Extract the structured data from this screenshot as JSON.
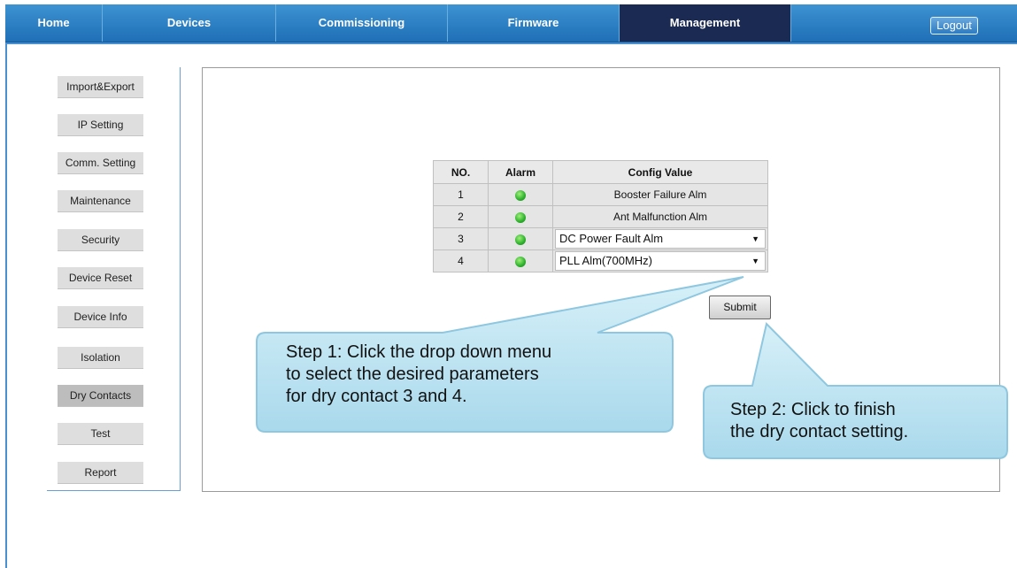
{
  "nav": {
    "items": [
      "Home",
      "Devices",
      "Commissioning",
      "Firmware",
      "Management"
    ],
    "active": "Management",
    "logout": "Logout"
  },
  "sidebar": {
    "items": [
      "Import&Export",
      "IP Setting",
      "Comm. Setting",
      "Maintenance",
      "Security",
      "Device Reset",
      "Device Info",
      "Isolation",
      "Dry Contacts",
      "Test",
      "Report"
    ],
    "active": "Dry Contacts"
  },
  "table": {
    "headers": [
      "NO.",
      "Alarm",
      "Config Value"
    ],
    "rows": [
      {
        "no": "1",
        "value": "Booster Failure Alm"
      },
      {
        "no": "2",
        "value": "Ant Malfunction Alm"
      },
      {
        "no": "3",
        "value": "DC Power Fault Alm"
      },
      {
        "no": "4",
        "value": "PLL Alm(700MHz)"
      }
    ]
  },
  "submit": "Submit",
  "callouts": {
    "step1": [
      "Step 1: Click the drop down menu",
      "to select the desired parameters",
      "for dry contact 3 and 4."
    ],
    "step2": [
      "Step 2: Click to finish",
      "the dry contact setting."
    ]
  },
  "colors": {
    "nav": "#2b7fc4",
    "active_nav": "#1a2a52",
    "callout": "#bde5f2",
    "led": "#2bb02b"
  }
}
